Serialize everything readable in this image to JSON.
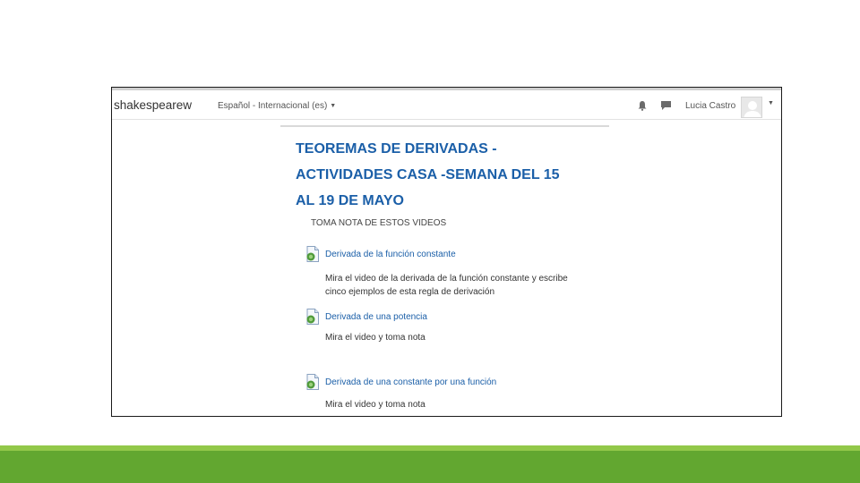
{
  "navbar": {
    "brand": "shakespearew",
    "language": "Español - Internacional (es)",
    "user_name": "Lucia Castro"
  },
  "icons": {
    "notifications": "bell-icon",
    "messages": "chat-bubble-icon",
    "user_menu": "chevron-down-icon",
    "activity": "video-file-icon"
  },
  "colors": {
    "link": "#1b5fa8",
    "footer_light": "#92c849",
    "footer_dark": "#62a730"
  },
  "section": {
    "title_lines": [
      "TEOREMAS DE DERIVADAS -",
      "ACTIVIDADES CASA -SEMANA DEL 15",
      "AL 19 DE MAYO"
    ],
    "subheading": "TOMA NOTA DE ESTOS VIDEOS"
  },
  "activities": [
    {
      "link": "Derivada de la función constante",
      "desc": "Mira el video de la derivada de la función constante y escribe cinco ejemplos de esta regla de derivación"
    },
    {
      "link": "Derivada de una potencia",
      "desc": "Mira el video y toma nota"
    },
    {
      "link": "Derivada de una constante por una función",
      "desc": "Mira el video y toma nota"
    }
  ]
}
